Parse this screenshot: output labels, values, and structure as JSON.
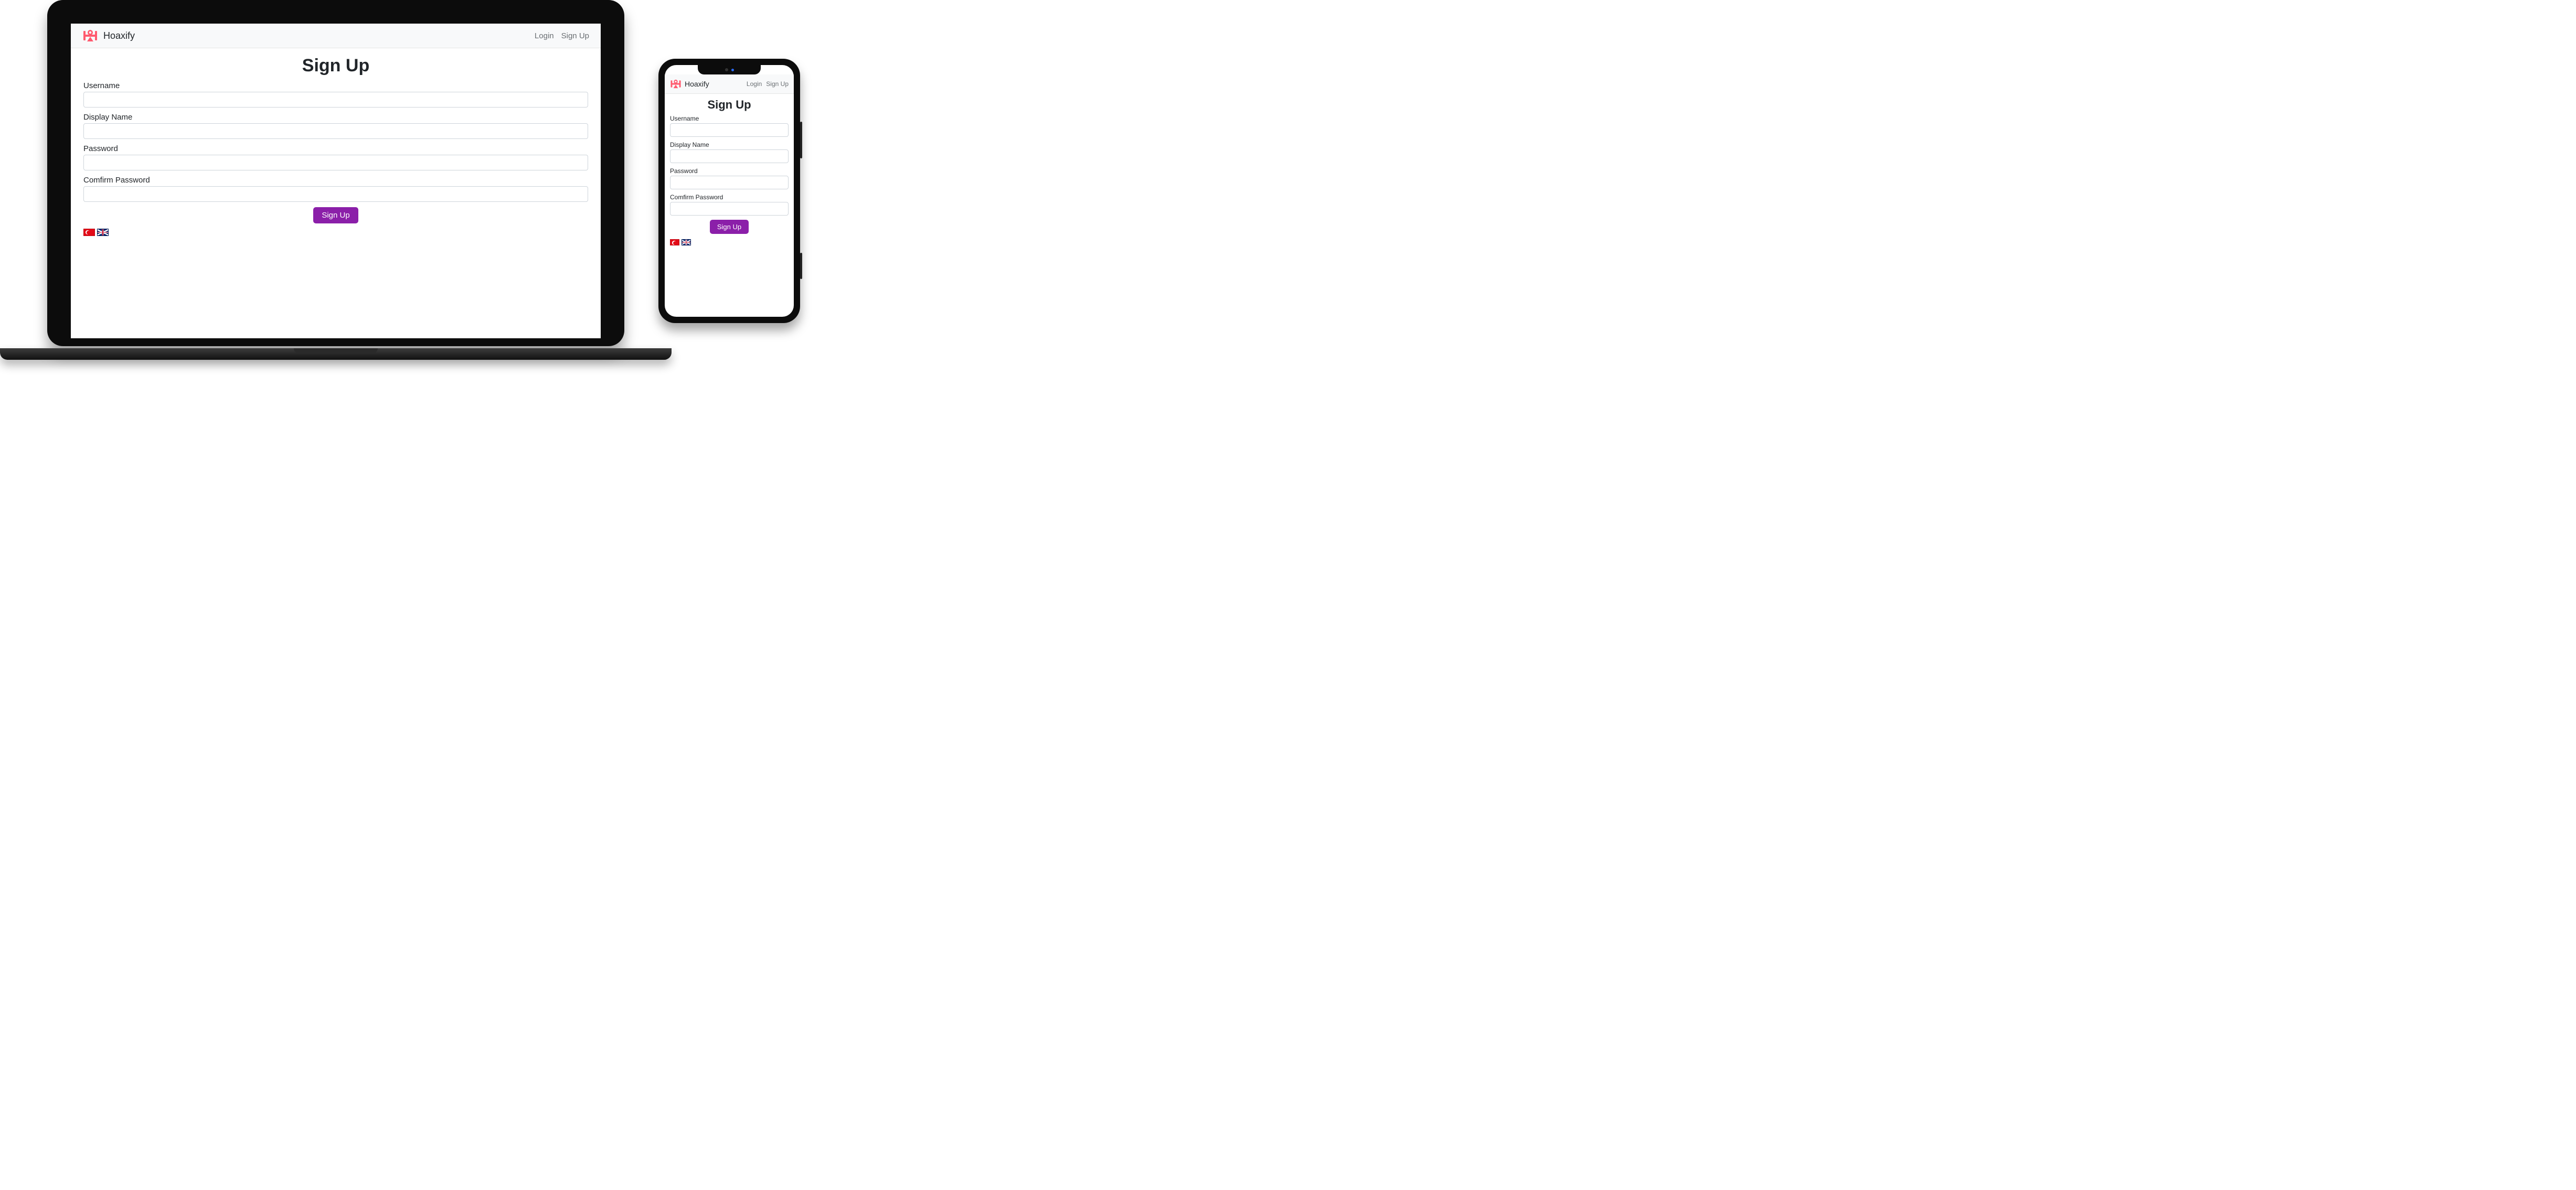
{
  "brand": {
    "name": "Hoaxify",
    "logo_color": "#ff5a6e"
  },
  "nav": {
    "login": "Login",
    "signup": "Sign Up"
  },
  "page": {
    "title": "Sign Up"
  },
  "form": {
    "username_label": "Username",
    "displayname_label": "Display Name",
    "password_label": "Password",
    "confirmpassword_label": "Comfirm Password",
    "submit_label": "Sign Up",
    "username_value": "",
    "displayname_value": "",
    "password_value": "",
    "confirmpassword_value": ""
  },
  "languages": [
    {
      "code": "tr",
      "name": "Türkçe"
    },
    {
      "code": "en",
      "name": "English (UK)"
    }
  ],
  "colors": {
    "button_bg": "#8b1fa9",
    "navbar_bg": "#f8f9fa"
  }
}
